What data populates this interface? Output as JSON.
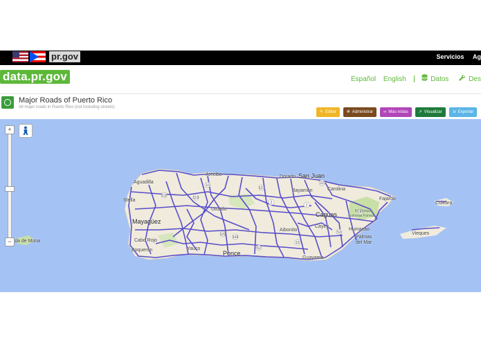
{
  "topbar": {
    "flags": [
      "us-flag",
      "puerto-rico-flag"
    ],
    "site_badge": "pr.gov",
    "nav": [
      {
        "label": "Servicios"
      },
      {
        "label": "Ag"
      }
    ]
  },
  "header": {
    "logo": "data.pr.gov",
    "languages": [
      "Español",
      "English"
    ],
    "nav": [
      {
        "label": "Datos",
        "icon": "database-icon"
      },
      {
        "label": "Desa",
        "icon": "wrench-icon"
      }
    ]
  },
  "dataset": {
    "title": "Major Roads of Puerto Rico",
    "subtitle": "All major roads in Puerto Rico (not including streets).",
    "actions": [
      {
        "label": "Editar",
        "icon": "pencil-icon",
        "color": "#f0b626"
      },
      {
        "label": "Administrar",
        "icon": "gear-icon",
        "color": "#7a4a1f"
      },
      {
        "label": "Más vistas",
        "icon": "binoculars-icon",
        "color": "#b146b8"
      },
      {
        "label": "Visualizar",
        "icon": "chart-icon",
        "color": "#1f7a3c"
      },
      {
        "label": "Exportar",
        "icon": "export-icon",
        "color": "#5bb5e6"
      }
    ]
  },
  "map": {
    "colors": {
      "water": "#a4c3f4",
      "land": "#f0ebdd",
      "forest": "#c8dfa6",
      "roads": "#4f44c9"
    },
    "controls": {
      "zoom_in": "+",
      "zoom_out": "−",
      "street_view": "pegman-icon"
    },
    "labels": {
      "san_juan": "San Juan",
      "arecibo": "Arecibo",
      "dorado": "Dorado",
      "bayamon": "Bayamón",
      "carolina": "Carolina",
      "aguadilla": "Aguadilla",
      "stella": "Stella",
      "mayaguez": "Mayagüez",
      "cabo_rojo": "Cabo Rojo",
      "boqueron": "Boquerón",
      "yauco": "Yauco",
      "utuado": "Utuado",
      "ponce": "Ponce",
      "caguas": "Caguas",
      "cayey": "Cayey",
      "guayama": "Guayama",
      "aibonito": "Aibonito",
      "fajardo": "Fajardo",
      "el_yunque": "El Yunque",
      "yunque_forest": "National Forest",
      "humacao": "Humacao",
      "palmas_del_mar": "Palmas del Mar",
      "culebra": "Culebra",
      "vieques": "Vieques",
      "isla_de_mona": "Isla de Mona"
    },
    "shields": [
      "111",
      "119",
      "10",
      "129",
      "143",
      "137",
      "52",
      "30",
      "2",
      "22",
      "53",
      "15",
      "1"
    ]
  }
}
